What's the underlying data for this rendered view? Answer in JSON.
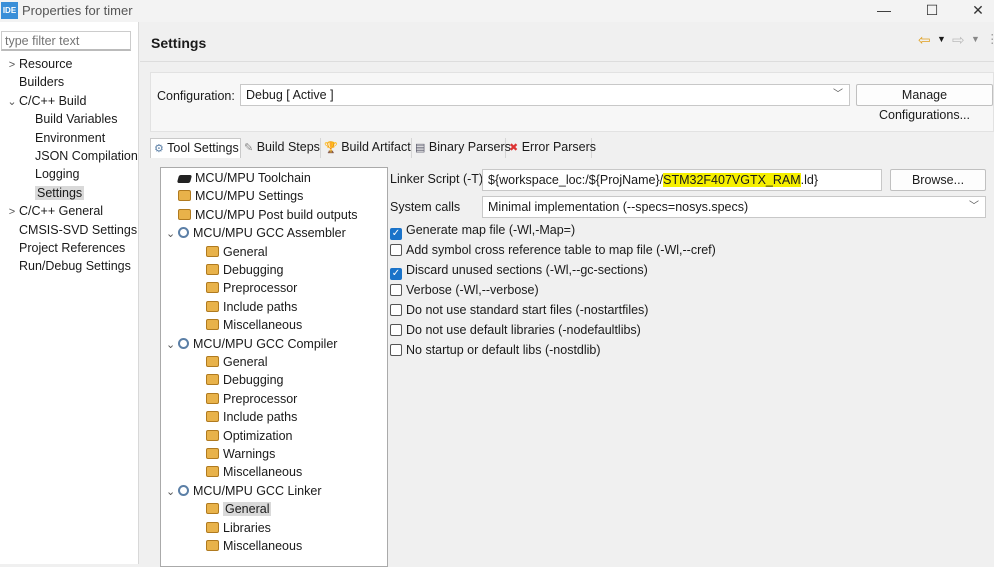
{
  "window": {
    "title": "Properties for timer",
    "logo": "IDE",
    "minimize": "—",
    "maximize": "☐",
    "close": "✕"
  },
  "filter": {
    "placeholder": "type filter text"
  },
  "sidebar": {
    "items": [
      {
        "label": "Resource",
        "twisty": ">"
      },
      {
        "label": "Builders",
        "twisty": ""
      },
      {
        "label": "C/C++ Build",
        "twisty": "v"
      },
      {
        "label": "Build Variables",
        "twisty": ""
      },
      {
        "label": "Environment",
        "twisty": ""
      },
      {
        "label": "JSON Compilation",
        "twisty": ""
      },
      {
        "label": "Logging",
        "twisty": ""
      },
      {
        "label": "Settings",
        "twisty": ""
      },
      {
        "label": "C/C++ General",
        "twisty": ">"
      },
      {
        "label": "CMSIS-SVD Settings",
        "twisty": ""
      },
      {
        "label": "Project References",
        "twisty": ""
      },
      {
        "label": "Run/Debug Settings",
        "twisty": ""
      }
    ],
    "selected": "Settings"
  },
  "header": {
    "title": "Settings",
    "nav": {
      "back": "⇦",
      "fwd": "⇨",
      "menu": "⋮"
    }
  },
  "configuration": {
    "label": "Configuration:",
    "value": "Debug  [ Active ]",
    "manage_label": "Manage Configurations..."
  },
  "tabs": [
    {
      "label": "Tool Settings",
      "icon": "⚙"
    },
    {
      "label": "Build Steps",
      "icon": "✎"
    },
    {
      "label": "Build Artifact",
      "icon": "🏆"
    },
    {
      "label": "Binary Parsers",
      "icon": "▤"
    },
    {
      "label": "Error Parsers",
      "icon": "✖"
    }
  ],
  "tree": [
    {
      "label": "MCU/MPU Toolchain",
      "icon": "tool",
      "level": 0
    },
    {
      "label": "MCU/MPU Settings",
      "icon": "fold",
      "level": 0
    },
    {
      "label": "MCU/MPU Post build outputs",
      "icon": "fold",
      "level": 0
    },
    {
      "label": "MCU/MPU GCC Assembler",
      "icon": "gear",
      "level": 0,
      "twisty": "v"
    },
    {
      "label": "General",
      "icon": "fold",
      "level": 1
    },
    {
      "label": "Debugging",
      "icon": "fold",
      "level": 1
    },
    {
      "label": "Preprocessor",
      "icon": "fold",
      "level": 1
    },
    {
      "label": "Include paths",
      "icon": "fold",
      "level": 1
    },
    {
      "label": "Miscellaneous",
      "icon": "fold",
      "level": 1
    },
    {
      "label": "MCU/MPU GCC Compiler",
      "icon": "gear",
      "level": 0,
      "twisty": "v"
    },
    {
      "label": "General",
      "icon": "fold",
      "level": 1
    },
    {
      "label": "Debugging",
      "icon": "fold",
      "level": 1
    },
    {
      "label": "Preprocessor",
      "icon": "fold",
      "level": 1
    },
    {
      "label": "Include paths",
      "icon": "fold",
      "level": 1
    },
    {
      "label": "Optimization",
      "icon": "fold",
      "level": 1
    },
    {
      "label": "Warnings",
      "icon": "fold",
      "level": 1
    },
    {
      "label": "Miscellaneous",
      "icon": "fold",
      "level": 1
    },
    {
      "label": "MCU/MPU GCC Linker",
      "icon": "gear",
      "level": 0,
      "twisty": "v"
    },
    {
      "label": "General",
      "icon": "fold",
      "level": 1,
      "selected": true
    },
    {
      "label": "Libraries",
      "icon": "fold",
      "level": 1
    },
    {
      "label": "Miscellaneous",
      "icon": "fold",
      "level": 1
    }
  ],
  "linker": {
    "label": "Linker Script (-T)",
    "value_prefix": "${workspace_loc:/${ProjName}/",
    "value_highlight": "STM32F407VGTX_RAM",
    "value_suffix": ".ld}",
    "browse_label": "Browse...",
    "highlight_color": "#f6f000"
  },
  "syscalls": {
    "label": "System calls",
    "value": "Minimal implementation (--specs=nosys.specs)"
  },
  "options": [
    {
      "label": "Generate map file (-Wl,-Map=)",
      "checked": true
    },
    {
      "label": "Add symbol cross reference table to map file (-Wl,--cref)",
      "checked": false
    },
    {
      "label": "Discard unused sections (-Wl,--gc-sections)",
      "checked": true
    },
    {
      "label": "Verbose (-Wl,--verbose)",
      "checked": false
    },
    {
      "label": "Do not use standard start files (-nostartfiles)",
      "checked": false
    },
    {
      "label": "Do not use default libraries (-nodefaultlibs)",
      "checked": false
    },
    {
      "label": "No startup or default libs (-nostdlib)",
      "checked": false
    }
  ]
}
